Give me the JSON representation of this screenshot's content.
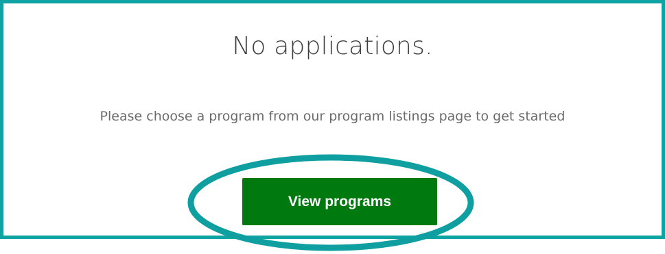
{
  "empty_state": {
    "title": "No applications.",
    "message": "Please choose a program from our program listings page to get started",
    "button_label": "View programs"
  },
  "colors": {
    "frame_border": "#0fa3a3",
    "highlight_ring": "#0f9fa0",
    "button_background": "#007a0e",
    "button_text": "#ffffff",
    "title_text": "#3d3d3d",
    "message_text": "#6b6b6b"
  }
}
